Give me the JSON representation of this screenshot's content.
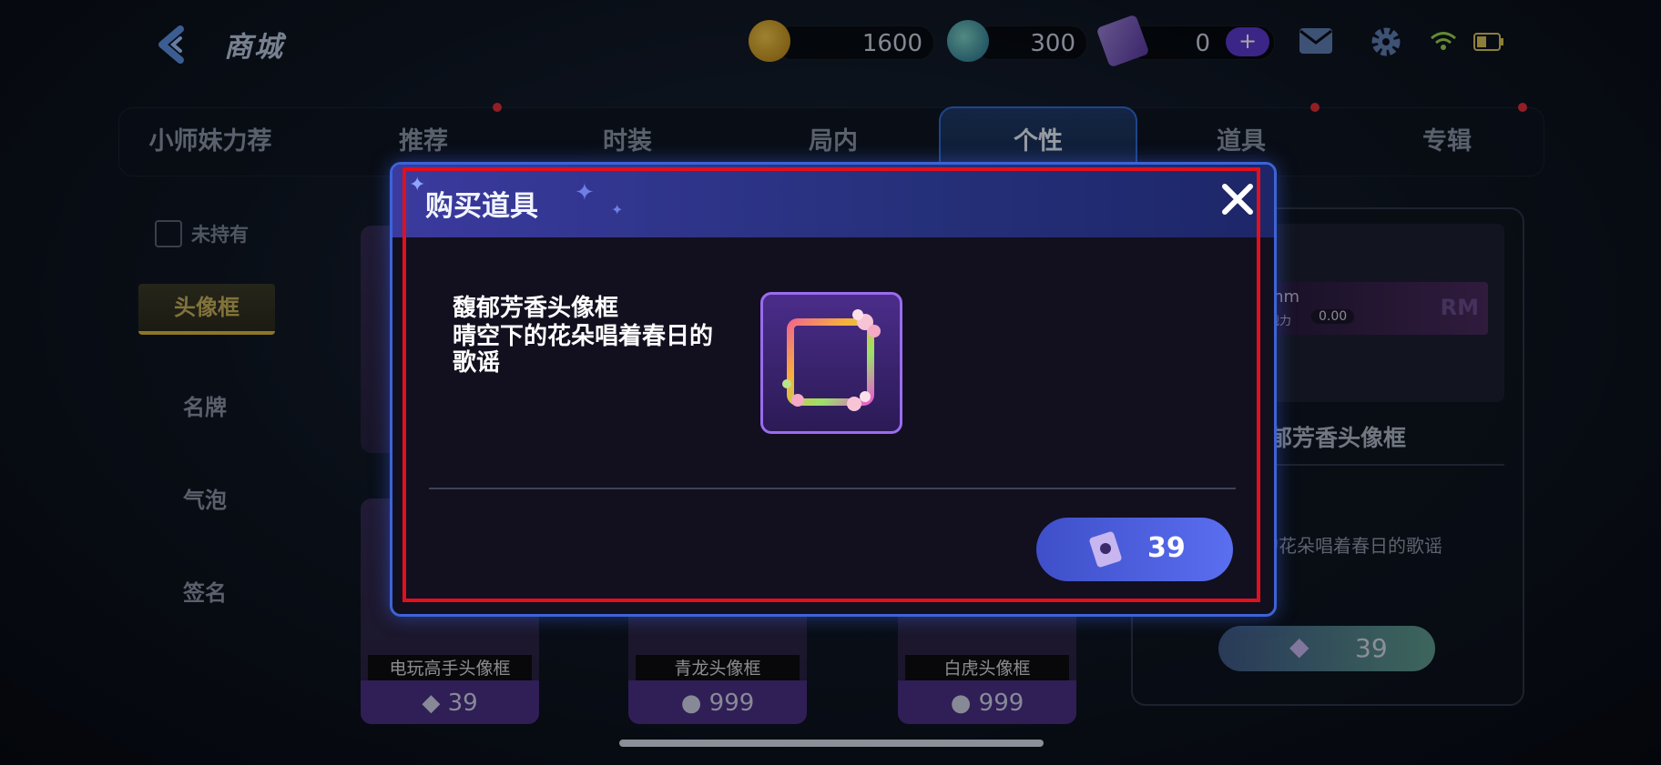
{
  "header": {
    "title": "商城",
    "currencies": [
      {
        "name": "music-coin",
        "value": "1600"
      },
      {
        "name": "gem",
        "value": "300"
      },
      {
        "name": "ticket",
        "value": "0"
      }
    ],
    "plus_label": "+"
  },
  "tabs": [
    {
      "label": "小师妹力荐",
      "dot": false
    },
    {
      "label": "推荐",
      "dot": true
    },
    {
      "label": "时装",
      "dot": false
    },
    {
      "label": "局内",
      "dot": false
    },
    {
      "label": "个性",
      "dot": false,
      "active": true
    },
    {
      "label": "道具",
      "dot": true
    },
    {
      "label": "专辑",
      "dot": true
    }
  ],
  "filter": {
    "label": "未持有"
  },
  "side_menu": [
    {
      "label": "头像框",
      "active": true
    },
    {
      "label": "名牌"
    },
    {
      "label": "气泡"
    },
    {
      "label": "签名"
    }
  ],
  "cards": [
    {
      "name": "电玩高手头像框",
      "price": "39"
    },
    {
      "name": "青龙头像框",
      "price": "999"
    },
    {
      "name": "白虎头像框",
      "price": "999"
    }
  ],
  "detail": {
    "preview_user": "mm",
    "preview_power_label": "战力",
    "preview_power_value": "0.00",
    "preview_badge": "RM",
    "name": "郁芳香头像框",
    "desc": "的花朵唱着春日的歌谣",
    "price": "39"
  },
  "dialog": {
    "title": "购买道具",
    "item_name": "馥郁芳香头像框",
    "item_desc": "晴空下的花朵唱着春日的歌谣",
    "price": "39",
    "highlight_color": "#e0101e",
    "accent": "#3d63d6"
  }
}
